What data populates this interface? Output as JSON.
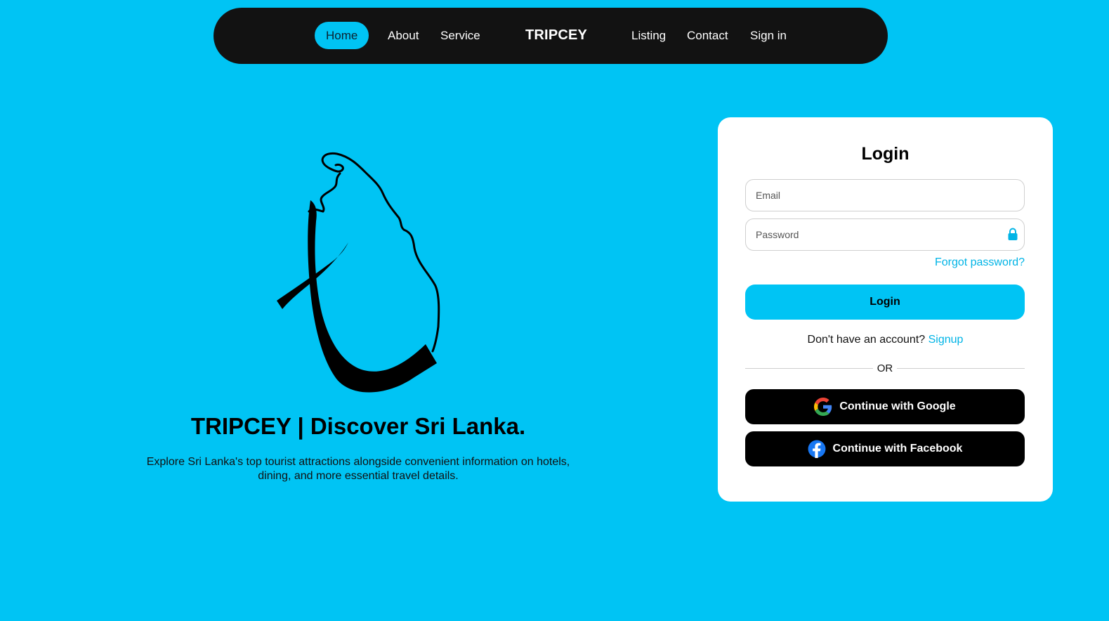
{
  "nav": {
    "items_left": [
      "Home",
      "About",
      "Service"
    ],
    "brand": "TRIPCEY",
    "items_right": [
      "Listing",
      "Contact",
      "Sign in"
    ],
    "active": "Home"
  },
  "hero": {
    "title": "TRIPCEY | Discover Sri Lanka.",
    "description": "Explore Sri Lanka's top tourist attractions alongside convenient information on hotels, dining, and more essential travel details."
  },
  "login": {
    "title": "Login",
    "email_placeholder": "Email",
    "password_placeholder": "Password",
    "forgot": "Forgot password?",
    "button": "Login",
    "no_account": "Don't have an account?",
    "signup": "Signup",
    "or": "OR",
    "google": "Continue with Google",
    "facebook": "Continue with Facebook"
  },
  "colors": {
    "background": "#00c4f4",
    "nav": "#121212",
    "accent_link": "#00b4e6",
    "button_dark": "#000000"
  }
}
